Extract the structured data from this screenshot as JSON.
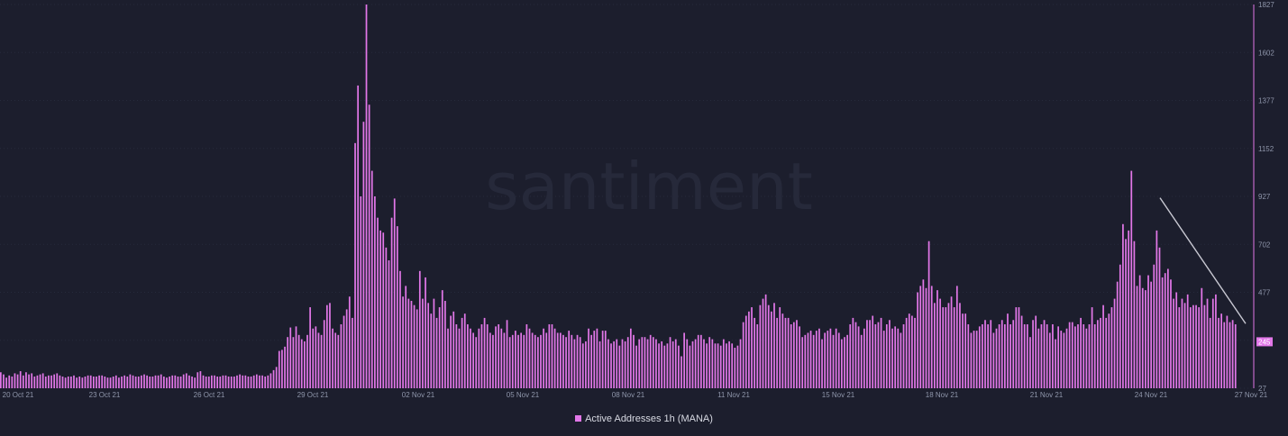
{
  "watermark": "santiment",
  "legend_label": "Active Addresses 1h (MANA)",
  "colors": {
    "bar": "#e277e8",
    "background": "#1c1e2d",
    "last_value_bg": "#e277e8",
    "trend_line": "#c9c9d3"
  },
  "chart_data": {
    "type": "bar",
    "title": "",
    "xlabel": "",
    "ylabel": "",
    "ylim": [
      27,
      1827
    ],
    "y_axis_position": "right",
    "y_ticks": [
      "1827",
      "1602",
      "1377",
      "1152",
      "927",
      "702",
      "477",
      "252",
      "27"
    ],
    "x_ticks": [
      "20 Oct 21",
      "23 Oct 21",
      "26 Oct 21",
      "29 Oct 21",
      "02 Nov 21",
      "05 Nov 21",
      "08 Nov 21",
      "11 Nov 21",
      "15 Nov 21",
      "18 Nov 21",
      "21 Nov 21",
      "24 Nov 21",
      "27 Nov 21"
    ],
    "last_value": "245",
    "grid": true,
    "legend_position": "bottom-center",
    "trend_line": {
      "from": [
        "24 Nov 21",
        920
      ],
      "to": [
        "27 Nov 21",
        330
      ]
    },
    "series": [
      {
        "name": "Active Addresses 1h (MANA)",
        "values": [
          75,
          65,
          50,
          60,
          55,
          70,
          65,
          80,
          60,
          75,
          65,
          70,
          55,
          60,
          65,
          70,
          55,
          60,
          60,
          65,
          70,
          60,
          55,
          50,
          55,
          55,
          60,
          50,
          55,
          50,
          55,
          60,
          60,
          55,
          55,
          60,
          60,
          55,
          50,
          50,
          55,
          60,
          50,
          55,
          60,
          55,
          65,
          60,
          55,
          55,
          60,
          65,
          60,
          55,
          55,
          60,
          60,
          65,
          55,
          50,
          55,
          60,
          60,
          55,
          55,
          65,
          70,
          60,
          55,
          50,
          75,
          80,
          60,
          55,
          55,
          60,
          60,
          55,
          55,
          60,
          60,
          55,
          55,
          55,
          60,
          65,
          60,
          60,
          55,
          55,
          60,
          65,
          60,
          60,
          55,
          60,
          70,
          85,
          100,
          175,
          180,
          195,
          240,
          285,
          240,
          290,
          250,
          230,
          220,
          250,
          380,
          280,
          290,
          260,
          250,
          320,
          390,
          400,
          280,
          260,
          250,
          300,
          340,
          370,
          430,
          330,
          1150,
          1420,
          900,
          1250,
          1820,
          1330,
          1020,
          900,
          800,
          740,
          730,
          660,
          600,
          800,
          890,
          760,
          550,
          430,
          480,
          420,
          410,
          390,
          370,
          550,
          420,
          520,
          400,
          350,
          420,
          330,
          380,
          460,
          410,
          280,
          340,
          360,
          300,
          280,
          330,
          350,
          300,
          280,
          260,
          240,
          280,
          300,
          330,
          300,
          260,
          250,
          290,
          300,
          280,
          260,
          320,
          240,
          250,
          270,
          250,
          260,
          250,
          300,
          280,
          260,
          250,
          240,
          250,
          280,
          260,
          300,
          300,
          280,
          260,
          260,
          250,
          240,
          270,
          250,
          230,
          250,
          240,
          210,
          220,
          280,
          250,
          270,
          280,
          220,
          270,
          270,
          230,
          210,
          220,
          230,
          200,
          230,
          220,
          240,
          280,
          250,
          200,
          230,
          240,
          240,
          230,
          250,
          240,
          230,
          210,
          220,
          200,
          210,
          240,
          220,
          230,
          200,
          150,
          260,
          230,
          200,
          220,
          230,
          250,
          250,
          230,
          210,
          240,
          230,
          210,
          210,
          200,
          230,
          210,
          220,
          210,
          190,
          200,
          230,
          310,
          340,
          360,
          380,
          330,
          300,
          390,
          420,
          440,
          390,
          360,
          400,
          330,
          380,
          350,
          330,
          330,
          300,
          310,
          320,
          290,
          240,
          250,
          260,
          270,
          250,
          270,
          280,
          230,
          260,
          270,
          280,
          250,
          280,
          260,
          230,
          240,
          250,
          300,
          330,
          310,
          290,
          250,
          280,
          320,
          320,
          340,
          300,
          310,
          330,
          270,
          300,
          320,
          280,
          290,
          280,
          260,
          300,
          330,
          350,
          340,
          330,
          450,
          480,
          510,
          470,
          690,
          480,
          400,
          460,
          420,
          380,
          380,
          400,
          430,
          380,
          480,
          400,
          350,
          350,
          300,
          260,
          270,
          270,
          290,
          300,
          320,
          300,
          320,
          260,
          280,
          300,
          320,
          300,
          350,
          300,
          320,
          380,
          380,
          340,
          300,
          300,
          240,
          320,
          340,
          280,
          300,
          320,
          300,
          260,
          300,
          230,
          290,
          270,
          260,
          280,
          310,
          310,
          290,
          300,
          330,
          300,
          280,
          300,
          380,
          300,
          320,
          330,
          390,
          330,
          350,
          380,
          420,
          500,
          580,
          770,
          700,
          740,
          1020,
          690,
          480,
          530,
          470,
          460,
          530,
          500,
          580,
          740,
          660,
          520,
          540,
          560,
          510,
          420,
          450,
          380,
          420,
          400,
          440,
          380,
          390,
          390,
          380,
          470,
          390,
          420,
          330,
          420,
          440,
          330,
          350,
          310,
          340,
          310,
          320,
          300
        ],
        "note_values_units": "raw y-units offset from 0; ylim min is 27"
      }
    ]
  }
}
